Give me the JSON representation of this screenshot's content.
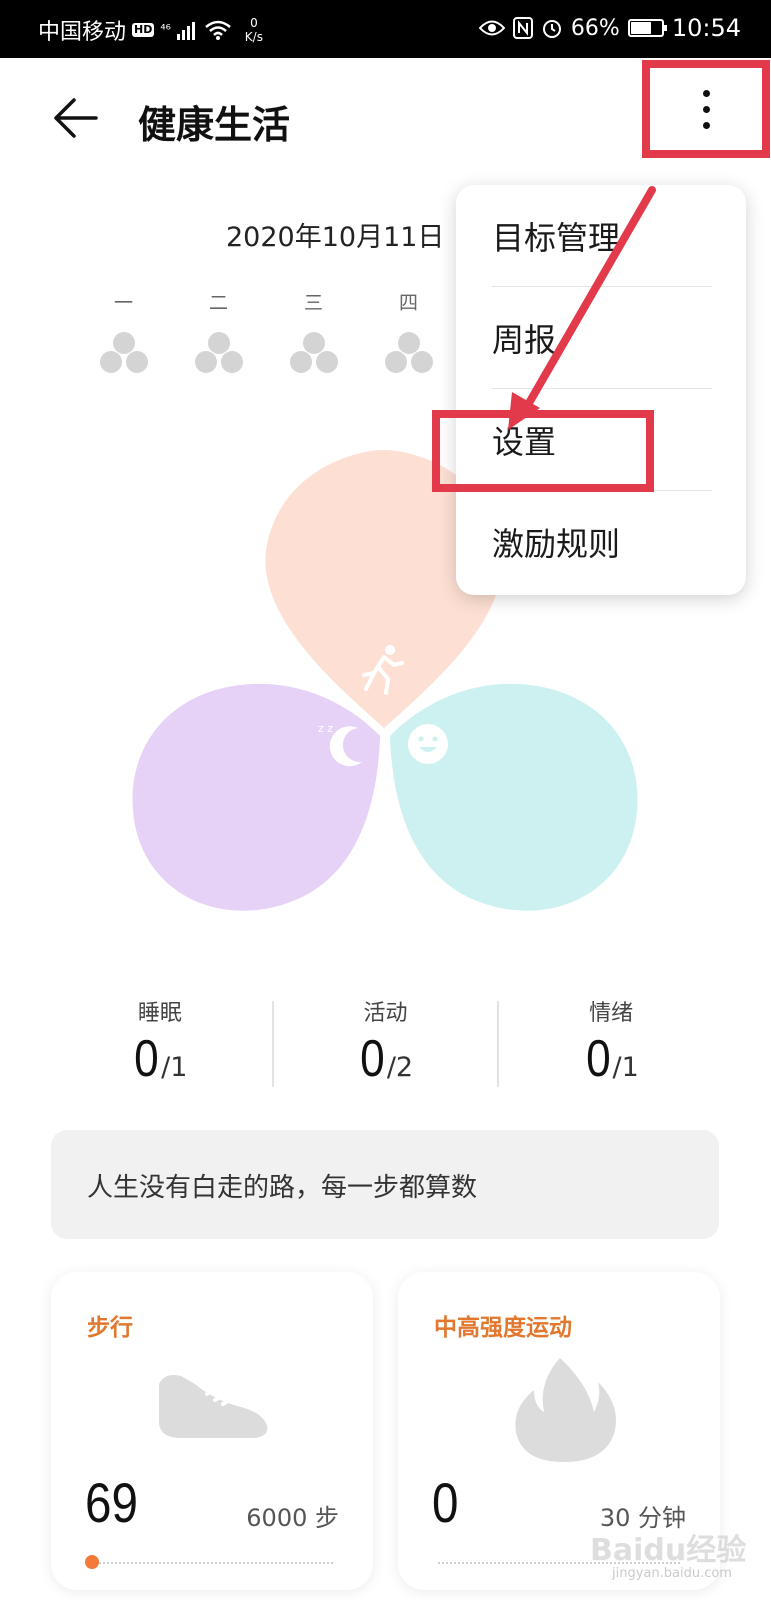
{
  "status_bar": {
    "carrier": "中国移动",
    "hd": "HD",
    "network": "⁴⁶",
    "speed_value": "0",
    "speed_unit": "K/s",
    "battery_percent": "66%",
    "battery_level": 0.66,
    "time": "10:54"
  },
  "header": {
    "title": "健康生活"
  },
  "date": "2020年10月11日",
  "week_days": [
    "一",
    "二",
    "三",
    "四"
  ],
  "menu": {
    "items": [
      "目标管理",
      "周报",
      "设置",
      "激励规则"
    ]
  },
  "stats": [
    {
      "label": "睡眠",
      "value": "0",
      "total": "/1"
    },
    {
      "label": "活动",
      "value": "0",
      "total": "/2"
    },
    {
      "label": "情绪",
      "value": "0",
      "total": "/1"
    }
  ],
  "quote": "人生没有白走的路，每一步都算数",
  "cards": [
    {
      "title": "步行",
      "value": "69",
      "goal": "6000 步",
      "icon": "shoe-icon"
    },
    {
      "title": "中高强度运动",
      "value": "0",
      "goal": "30 分钟",
      "icon": "flame-icon"
    }
  ],
  "watermark": "Baidu经验",
  "watermark_sub": "jingyan.baidu.com",
  "colors": {
    "highlight": "#e23a4a",
    "accent": "#e2782f",
    "petal_activity": "#fde0d3",
    "petal_sleep": "#e6d1f7",
    "petal_mood": "#cdf1f1"
  }
}
